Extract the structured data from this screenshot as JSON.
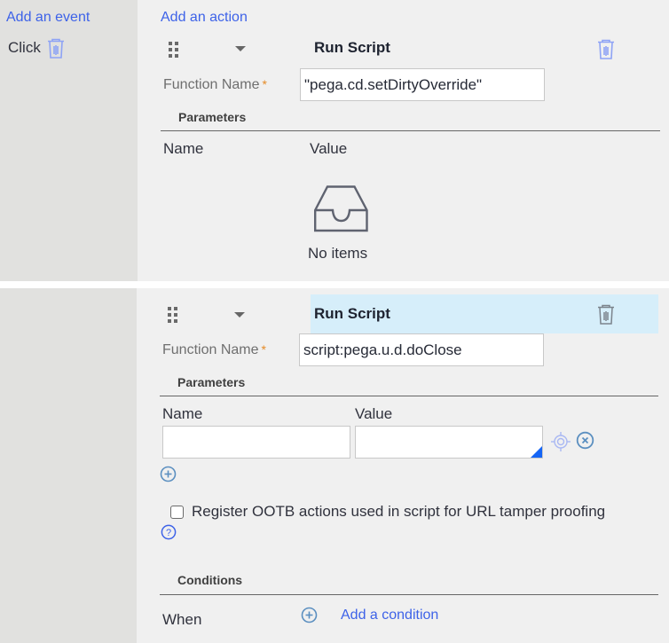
{
  "events": {
    "add_event_label": "Add an event",
    "items": [
      {
        "label": "Click"
      }
    ]
  },
  "actions": {
    "add_action_label": "Add an action",
    "list": [
      {
        "type": "Run Script",
        "function_name_label": "Function Name",
        "required_marker": "*",
        "function_name_value": "\"pega.cd.setDirtyOverride\"",
        "parameters_heading": "Parameters",
        "columns": [
          "Name",
          "Value"
        ],
        "empty_state": {
          "icon": "inbox-icon",
          "text": "No items"
        },
        "selected": false
      },
      {
        "type": "Run Script",
        "function_name_label": "Function Name",
        "required_marker": "*",
        "function_name_value": "script:pega.u.d.doClose",
        "parameters_heading": "Parameters",
        "columns": [
          "Name",
          "Value"
        ],
        "parameter_rows": [
          {
            "name": "",
            "value": ""
          }
        ],
        "register_ootb_label": "Register OOTB actions used in script for URL tamper proofing",
        "register_ootb_checked": false,
        "conditions_heading": "Conditions",
        "when_label": "When",
        "add_condition_label": "Add a condition",
        "selected": true
      }
    ]
  },
  "colors": {
    "link": "#3d62e8",
    "required": "#e58b26",
    "selected_header": "#d6eefa",
    "panel_bg": "#f0f0f0",
    "left_col_bg": "#e1e1df"
  }
}
